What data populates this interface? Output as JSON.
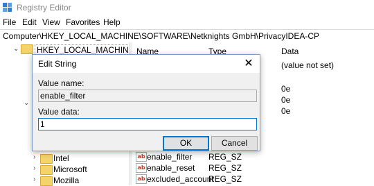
{
  "window": {
    "title": "Registry Editor"
  },
  "menu": [
    "File",
    "Edit",
    "View",
    "Favorites",
    "Help"
  ],
  "address": "Computer\\HKEY_LOCAL_MACHINE\\SOFTWARE\\Netknights GmbH\\PrivacyIDEA-CP",
  "tree": {
    "root": "HKEY_LOCAL_MACHINE",
    "items": [
      "Intel",
      "Microsoft",
      "Mozilla"
    ]
  },
  "list": {
    "columns": {
      "name": "Name",
      "type": "Type",
      "data": "Data"
    },
    "default_value": "(value not set)",
    "data_partial": [
      "0e",
      "0e",
      "0e"
    ],
    "rows": [
      {
        "name": "enable_filter",
        "type": "REG_SZ"
      },
      {
        "name": "enable_reset",
        "type": "REG_SZ"
      },
      {
        "name": "excluded_account",
        "type": "REG_SZ"
      }
    ],
    "icon_text": "ab"
  },
  "dialog": {
    "title": "Edit String",
    "close_glyph": "✕",
    "value_name_label": "Value name:",
    "value_name": "enable_filter",
    "value_data_label": "Value data:",
    "value_data": "1",
    "ok_label": "OK",
    "cancel_label": "Cancel"
  },
  "colors": {
    "accent": "#0078d7",
    "folder": "#f4d36b"
  }
}
